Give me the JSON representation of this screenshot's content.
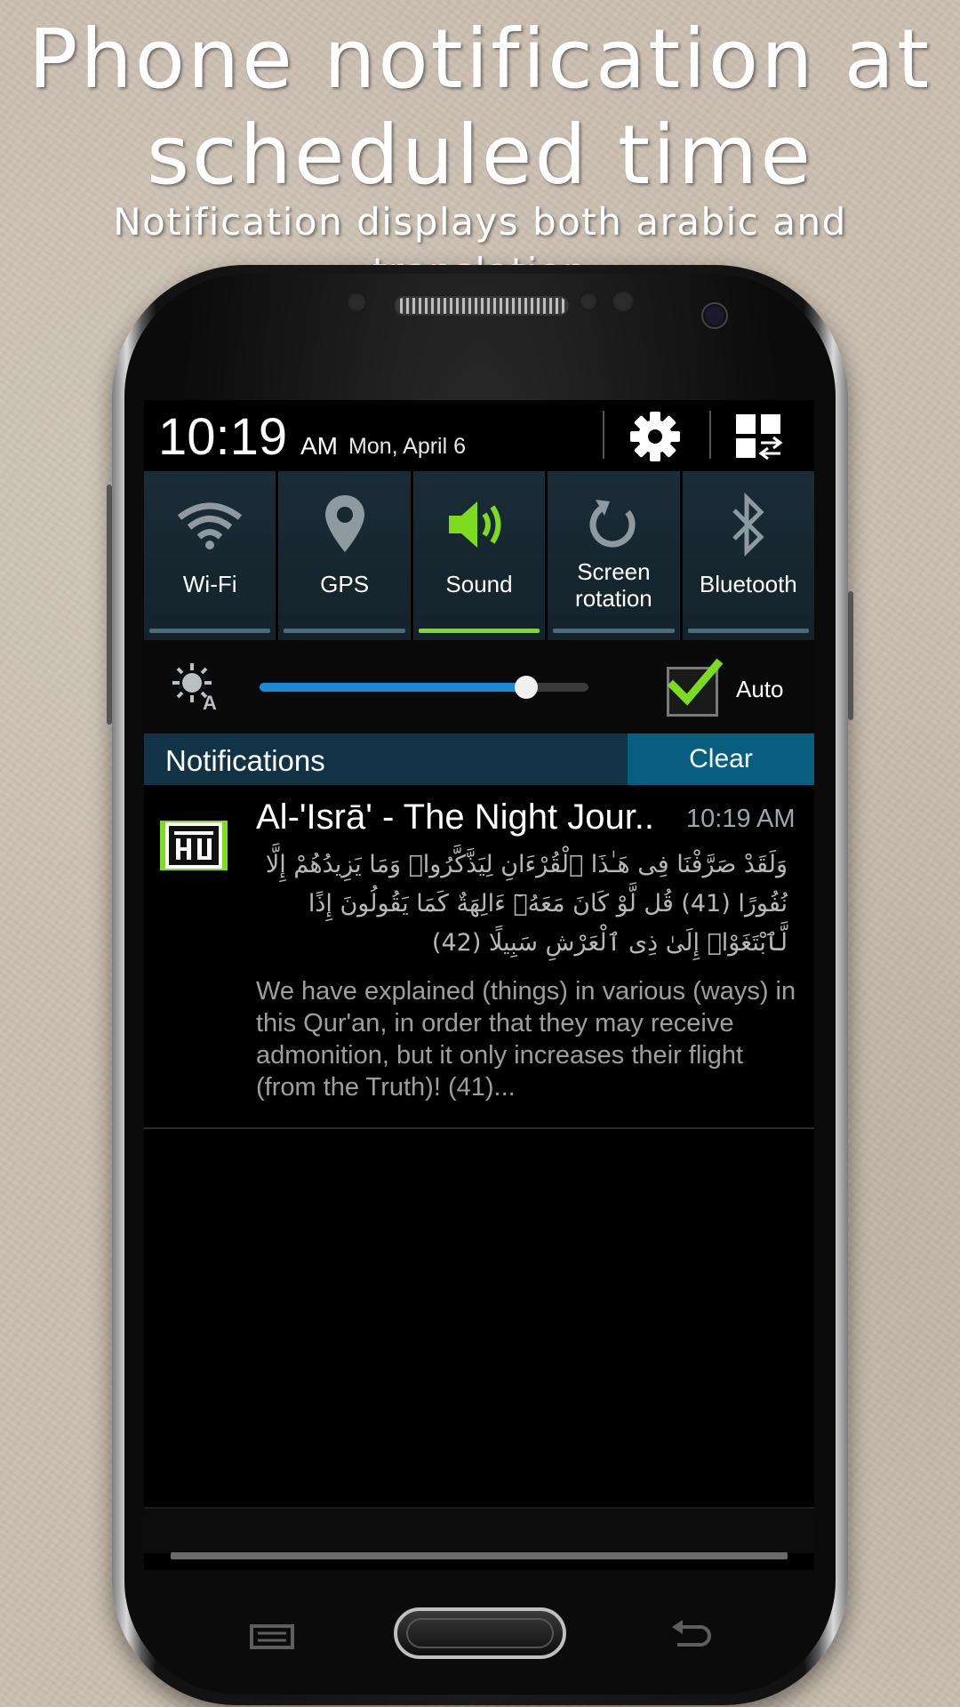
{
  "headline": {
    "line1": "Phone notification at",
    "line2": "scheduled time",
    "subtitle": "Notification displays both arabic and translation"
  },
  "status_bar": {
    "time": "10:19",
    "ampm": "AM",
    "date": "Mon, April 6",
    "icons": [
      "gear-icon",
      "grid-toggle-icon"
    ]
  },
  "quick_settings": [
    {
      "label": "Wi-Fi",
      "icon": "wifi-icon",
      "active": false
    },
    {
      "label": "GPS",
      "icon": "location-pin-icon",
      "active": false
    },
    {
      "label": "Sound",
      "icon": "speaker-icon",
      "active": true
    },
    {
      "label": "Screen rotation",
      "icon": "rotate-icon",
      "active": false
    },
    {
      "label": "Bluetooth",
      "icon": "bluetooth-icon",
      "active": false
    }
  ],
  "brightness": {
    "level_fraction": 0.81,
    "auto_label": "Auto",
    "auto_checked": true
  },
  "notifications": {
    "header": "Notifications",
    "clear_label": "Clear",
    "item": {
      "title": "Al-'Isrā' - The Night Jour..",
      "time": "10:19 AM",
      "arabic": "وَلَقَدْ صَرَّفْنَا فِى هَـٰذَا ٱلْقُرْءَانِ لِيَذَّكَّرُوا۟ وَمَا يَزِيدُهُمْ إِلَّا نُفُورًا (41) قُل لَّوْ كَانَ مَعَهُۥٓ ءَالِهَةٌ كَمَا يَقُولُونَ إِذًا لَّٱبْتَغَوْا۟ إِلَىٰ ذِى ٱلْعَرْشِ سَبِيلًا (42)",
      "english": "We have explained (things) in various (ways) in this Qur'an, in order that they may receive admonition, but it only increases their flight (from the Truth)! (41)..."
    }
  },
  "colors": {
    "accent_active": "#7ddc1f",
    "slider_fill": "#1c8ad8",
    "notif_header_bg": "#113345",
    "clear_bg": "#075e80"
  }
}
